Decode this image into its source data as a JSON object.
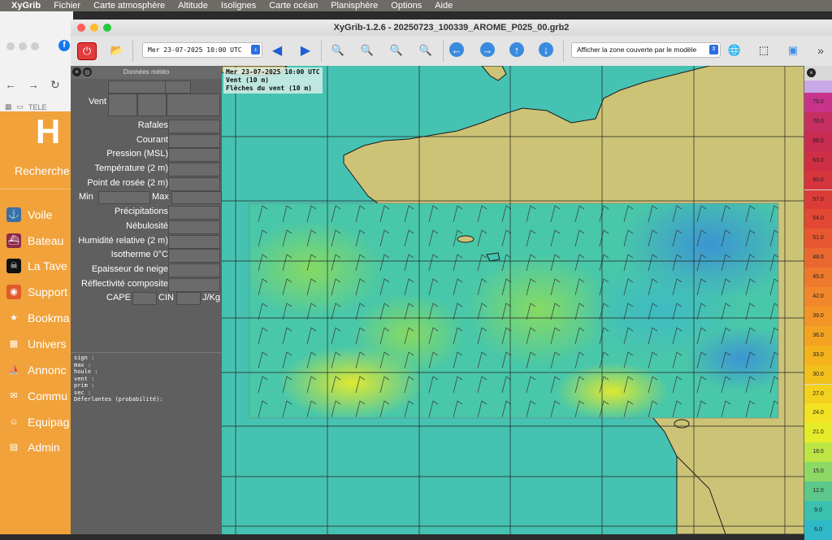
{
  "menubar": {
    "app": "XyGrib",
    "items": [
      "Fichier",
      "Carte atmosphère",
      "Altitude",
      "Isolignes",
      "Carte océan",
      "Planisphère",
      "Options",
      "Aide"
    ]
  },
  "browser": {
    "bookmark": "TELE",
    "logo": "H",
    "search": "Recherche",
    "nav": [
      {
        "label": "Voile",
        "icon": "anchor-icon",
        "color": "#3a6ea5"
      },
      {
        "label": "Bateau",
        "icon": "ship-icon",
        "color": "#8e2a4a"
      },
      {
        "label": "La Tave",
        "icon": "skull-icon",
        "color": "#111111"
      },
      {
        "label": "Support",
        "icon": "lifebuoy-icon",
        "color": "#e05a2a"
      },
      {
        "label": "Bookma",
        "icon": "star-icon",
        "color": "#f1a23a"
      },
      {
        "label": "Univers",
        "icon": "grid-icon",
        "color": "#f1a23a"
      },
      {
        "label": "Annonc",
        "icon": "boat-icon",
        "color": "#f1a23a"
      },
      {
        "label": "Commu",
        "icon": "chat-icon",
        "color": "#f1a23a"
      },
      {
        "label": "Equipag",
        "icon": "user-icon",
        "color": "#f1a23a"
      },
      {
        "label": "Admin",
        "icon": "table-icon",
        "color": "#f1a23a"
      }
    ]
  },
  "xygrib": {
    "title": "XyGrib-1.2.6 - 20250723_100339_AROME_P025_00.grb2",
    "date_select": "Mer 23-07-2025 10:00 UTC",
    "zone_select": "Afficher la zone couverte par le modèle",
    "panel": {
      "header": "Données météo",
      "rows": {
        "vent": "Vent",
        "rafales": "Rafales",
        "courant": "Courant",
        "pression": "Pression (MSL)",
        "temperature": "Température (2 m)",
        "rosee": "Point de rosée (2 m)",
        "min": "Min",
        "max": "Max",
        "precipitations": "Précipitations",
        "nebulosite": "Nébulosité",
        "humidite": "Humidité relative (2 m)",
        "isotherme": "Isotherme 0°C",
        "neige": "Epaisseur de neige",
        "reflectivite": "Réflectivité composite",
        "cape": "CAPE",
        "cin": "CIN",
        "jkg": "J/Kg"
      },
      "details": "sign :\nmax :\nhoule :\nvent :\nprim :\nsec :\nDéferlantes (probabilité):"
    },
    "map_info": "Mer 23-07-2025 10:00 UTC\nVent (10 m)\nFlèches du vent (10 m)",
    "scale": [
      "75.0",
      "70.0",
      "66.0",
      "63.0",
      "60.0",
      "57.0",
      "54.0",
      "51.0",
      "48.0",
      "45.0",
      "42.0",
      "39.0",
      "36.0",
      "33.0",
      "30.0",
      "27.0",
      "24.0",
      "21.0",
      "18.0",
      "15.0",
      "12.0",
      "9.0",
      "6.0"
    ],
    "scale_colors": [
      "#c8348c",
      "#c52f62",
      "#c82b50",
      "#cf2f45",
      "#d7353e",
      "#dc3c38",
      "#e24834",
      "#e75831",
      "#ea682f",
      "#ee792c",
      "#f1872a",
      "#f39526",
      "#f4a321",
      "#f4b21c",
      "#f1c01b",
      "#f3d11e",
      "#f3e223",
      "#e6ec2a",
      "#bde545",
      "#8dd965",
      "#5cc98a",
      "#3cc0b0",
      "#2fb8c8"
    ]
  }
}
